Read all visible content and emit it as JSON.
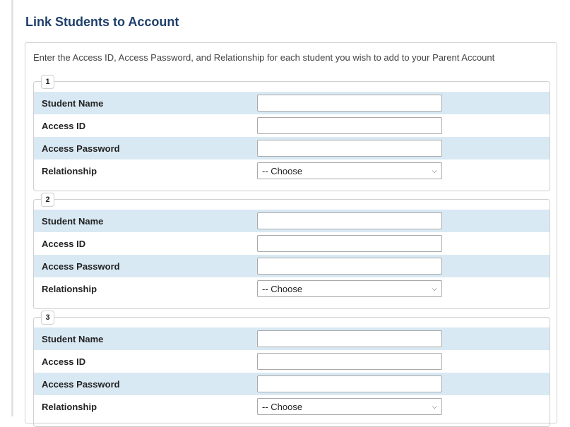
{
  "page": {
    "title": "Link Students to Account",
    "instructions": "Enter the Access ID, Access Password, and Relationship for each student you wish to add to your Parent Account"
  },
  "students": [
    {
      "number": "1",
      "name_label": "Student Name",
      "name_value": "",
      "access_id_label": "Access ID",
      "access_id_value": "",
      "password_label": "Access Password",
      "password_value": "",
      "relationship_label": "Relationship",
      "relationship_selected": "-- Choose"
    },
    {
      "number": "2",
      "name_label": "Student Name",
      "name_value": "",
      "access_id_label": "Access ID",
      "access_id_value": "",
      "password_label": "Access Password",
      "password_value": "",
      "relationship_label": "Relationship",
      "relationship_selected": "-- Choose"
    },
    {
      "number": "3",
      "name_label": "Student Name",
      "name_value": "",
      "access_id_label": "Access ID",
      "access_id_value": "",
      "password_label": "Access Password",
      "password_value": "",
      "relationship_label": "Relationship",
      "relationship_selected": "-- Choose"
    }
  ],
  "icons": {
    "select_arrow": "chevron-down-icon"
  },
  "colors": {
    "title": "#1f3f6b",
    "row_shade": "#d9e9f4",
    "border": "#cfcfcf"
  }
}
